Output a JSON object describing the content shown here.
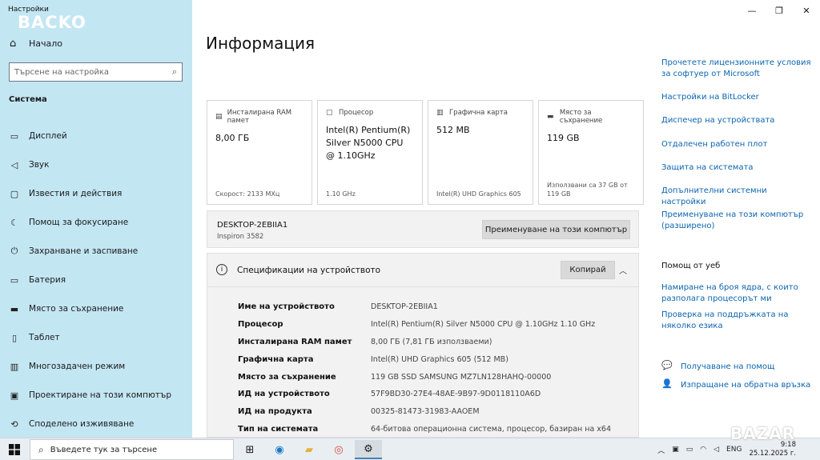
{
  "window": {
    "title": "Настройки",
    "brand_watermark": "BACKO",
    "controls": {
      "minimize": "—",
      "maximize": "❐",
      "close": "✕"
    }
  },
  "sidebar": {
    "home_label": "Начало",
    "search_placeholder": "Търсене на настройка",
    "section": "Система",
    "items": [
      {
        "label": "Дисплей",
        "icon": "display-icon",
        "glyph": "▭"
      },
      {
        "label": "Звук",
        "icon": "speaker-icon",
        "glyph": "🔊"
      },
      {
        "label": "Известия и действия",
        "icon": "notification-icon",
        "glyph": "▢"
      },
      {
        "label": "Помощ за фокусиране",
        "icon": "moon-icon",
        "glyph": "☾"
      },
      {
        "label": "Захранване и заспиване",
        "icon": "power-icon",
        "glyph": "⏻"
      },
      {
        "label": "Батерия",
        "icon": "battery-icon",
        "glyph": "▭"
      },
      {
        "label": "Място за съхранение",
        "icon": "storage-icon",
        "glyph": "▬"
      },
      {
        "label": "Таблет",
        "icon": "tablet-icon",
        "glyph": "▯"
      },
      {
        "label": "Многозадачен режим",
        "icon": "multitask-icon",
        "glyph": "▥"
      },
      {
        "label": "Проектиране на този компютър",
        "icon": "project-icon",
        "glyph": "▣"
      },
      {
        "label": "Споделено изживяване",
        "icon": "share-icon",
        "glyph": "✂"
      }
    ]
  },
  "main": {
    "title": "Информация",
    "cards": [
      {
        "label": "Инсталирана RAM памет",
        "icon": "ram-icon",
        "value": "8,00 ГБ",
        "footer": "Скорост: 2133 МХц"
      },
      {
        "label": "Процесор",
        "icon": "cpu-icon",
        "value": "Intel(R) Pentium(R) Silver N5000 CPU @ 1.10GHz",
        "footer": "1.10 GHz"
      },
      {
        "label": "Графична карта",
        "icon": "gpu-icon",
        "value": "512 MB",
        "footer": "Intel(R) UHD Graphics 605"
      },
      {
        "label": "Място за съхранение",
        "icon": "disk-icon",
        "value": "119 GB",
        "footer": "Използвани са 37 GB от 119 GB"
      }
    ],
    "device_name": "DESKTOP-2EBIIA1",
    "device_model": "Inspiron 3582",
    "rename_button": "Преименуване на този компютър",
    "specs": {
      "title": "Спецификации на устройството",
      "copy_button": "Копирай",
      "rows": [
        {
          "k": "Име на устройството",
          "v": "DESKTOP-2EBIIA1"
        },
        {
          "k": "Процесор",
          "v": "Intel(R) Pentium(R) Silver N5000 CPU @ 1.10GHz   1.10 GHz"
        },
        {
          "k": "Инсталирана RAM памет",
          "v": "8,00 ГБ (7,81 ГБ използваеми)"
        },
        {
          "k": "Графична карта",
          "v": "Intel(R) UHD Graphics 605 (512 MB)"
        },
        {
          "k": "Място за съхранение",
          "v": "119 GB SSD SAMSUNG MZ7LN128HAHQ-00000"
        },
        {
          "k": "ИД на устройството",
          "v": "57F9BD30-27E4-48AE-9B97-9D0118110A6D"
        },
        {
          "k": "ИД на продукта",
          "v": "00325-81473-31983-AAOEM"
        },
        {
          "k": "Тип на системата",
          "v": "64-битова операционна система, процесор, базиран на x64"
        }
      ]
    }
  },
  "right": {
    "links": [
      "Прочетете лицензионните условия за софтуер от Microsoft",
      "Настройки на BitLocker",
      "Диспечер на устройствата",
      "Отдалечен работен плот",
      "Защита на системата",
      "Допълнителни системни настройки",
      "Преименуване на този компютър (разширено)"
    ],
    "help_heading": "Помощ от уеб",
    "help_links": [
      "Намиране на броя ядра, с които разполага процесорът ми",
      "Проверка на поддръжката на няколко езика"
    ],
    "get_help": "Получаване на помощ",
    "feedback": "Изпращане на обратна връзка"
  },
  "taskbar": {
    "search_placeholder": "Въведете тук за търсене",
    "lang": "ENG",
    "time": "9:18",
    "date": "25.12.2025 г.",
    "watermark": "BAZAR"
  }
}
